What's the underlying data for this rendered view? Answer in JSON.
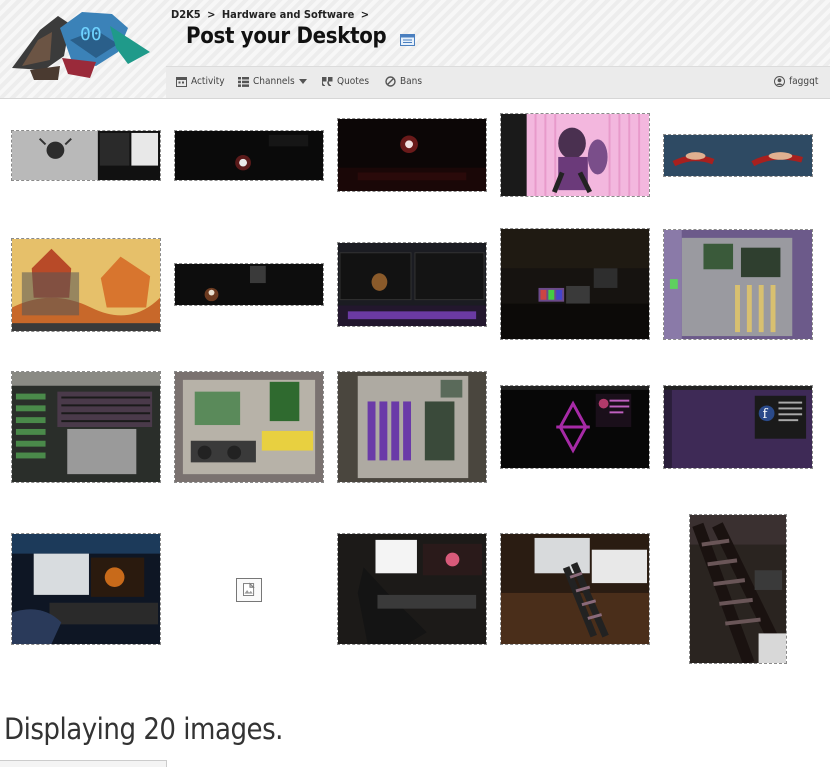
{
  "breadcrumb": {
    "items": [
      "D2K5",
      ">",
      "Hardware and Software",
      ">"
    ]
  },
  "page": {
    "title": "Post your Desktop"
  },
  "nav": {
    "activity": "Activity",
    "channels": "Channels",
    "quotes": "Quotes",
    "bans": "Bans",
    "user": "faggqt"
  },
  "gallery": {
    "status": "Displaying 20 images."
  },
  "colors": {
    "accent": "#3a7fc4",
    "header_bg": "#f2f2f2",
    "nav_bg": "#ebebeb"
  }
}
